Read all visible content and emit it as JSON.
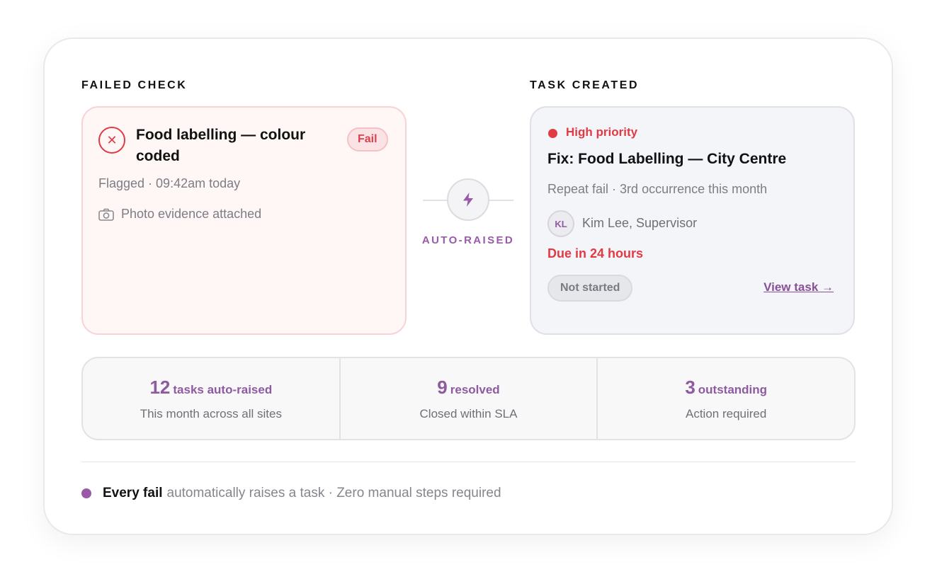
{
  "failed_check": {
    "heading": "FAILED CHECK",
    "title": "Food labelling — colour coded",
    "badge": "Fail",
    "flagged": "Flagged · 09:42am today",
    "photo": "Photo evidence attached"
  },
  "connector": {
    "label": "AUTO-RAISED",
    "icon": "lightning-bolt-icon"
  },
  "task_created": {
    "heading": "TASK CREATED",
    "priority": "High priority",
    "title": "Fix: Food Labelling — City Centre",
    "subtitle": "Repeat fail · 3rd occurrence this month",
    "avatar_initials": "KL",
    "assignee": "Kim Lee, Supervisor",
    "due": "Due in 24 hours",
    "status": "Not started",
    "link": "View task →"
  },
  "stats": [
    {
      "number": "12",
      "label": "tasks auto-raised",
      "sub": "This month across all sites"
    },
    {
      "number": "9",
      "label": "resolved",
      "sub": "Closed within SLA"
    },
    {
      "number": "3",
      "label": "outstanding",
      "sub": "Action required"
    }
  ],
  "footer": {
    "strong": "Every fail",
    "text": "automatically raises a task · Zero manual steps required"
  },
  "colors": {
    "accent": "#9a5aa8",
    "danger": "#e23a44"
  }
}
